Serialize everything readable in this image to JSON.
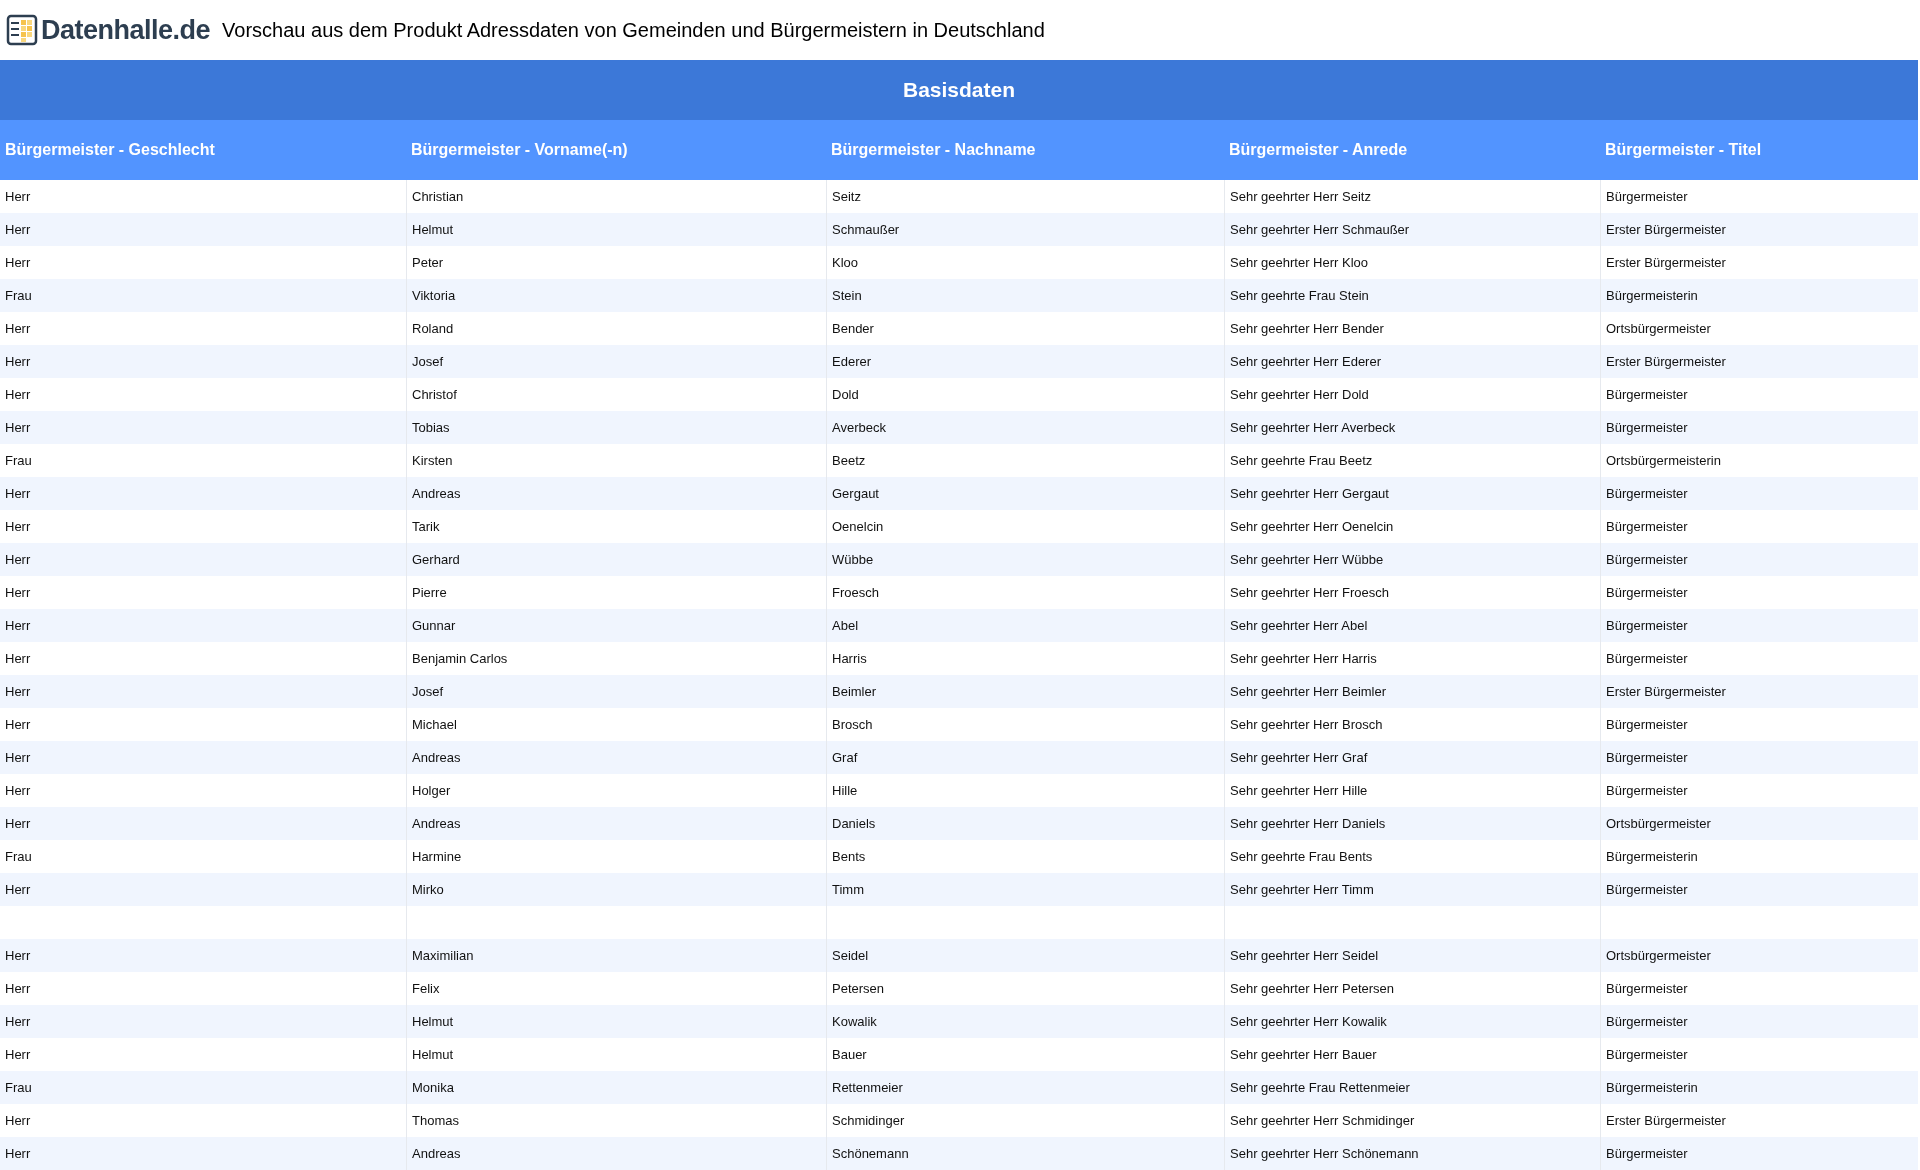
{
  "header": {
    "logo_text": "Datenhalle.de",
    "title": "Vorschau aus dem Produkt Adressdaten von Gemeinden und Bürgermeistern in Deutschland"
  },
  "section_title": "Basisdaten",
  "table": {
    "columns": [
      "Bürgermeister - Geschlecht",
      "Bürgermeister - Vorname(-n)",
      "Bürgermeister - Nachname",
      "Bürgermeister - Anrede",
      "Bürgermeister - Titel"
    ],
    "rows": [
      {
        "kind": "data",
        "cells": [
          "Herr",
          "Christian",
          "Seitz",
          "Sehr geehrter Herr Seitz",
          "Bürgermeister"
        ]
      },
      {
        "kind": "data",
        "cells": [
          "Herr",
          "Helmut",
          "Schmaußer",
          "Sehr geehrter Herr Schmaußer",
          "Erster Bürgermeister"
        ]
      },
      {
        "kind": "data",
        "cells": [
          "Herr",
          "Peter",
          "Kloo",
          "Sehr geehrter Herr Kloo",
          "Erster Bürgermeister"
        ]
      },
      {
        "kind": "data",
        "cells": [
          "Frau",
          "Viktoria",
          "Stein",
          "Sehr geehrte Frau Stein",
          "Bürgermeisterin"
        ]
      },
      {
        "kind": "data",
        "cells": [
          "Herr",
          "Roland",
          "Bender",
          "Sehr geehrter Herr Bender",
          "Ortsbürgermeister"
        ]
      },
      {
        "kind": "data",
        "cells": [
          "Herr",
          "Josef",
          "Ederer",
          "Sehr geehrter Herr Ederer",
          "Erster Bürgermeister"
        ]
      },
      {
        "kind": "data",
        "cells": [
          "Herr",
          "Christof",
          "Dold",
          "Sehr geehrter Herr Dold",
          "Bürgermeister"
        ]
      },
      {
        "kind": "data",
        "cells": [
          "Herr",
          "Tobias",
          "Averbeck",
          "Sehr geehrter Herr Averbeck",
          "Bürgermeister"
        ]
      },
      {
        "kind": "data",
        "cells": [
          "Frau",
          "Kirsten",
          "Beetz",
          "Sehr geehrte Frau Beetz",
          "Ortsbürgermeisterin"
        ]
      },
      {
        "kind": "data",
        "cells": [
          "Herr",
          "Andreas",
          "Gergaut",
          "Sehr geehrter Herr Gergaut",
          "Bürgermeister"
        ]
      },
      {
        "kind": "data",
        "cells": [
          "Herr",
          "Tarik",
          "Oenelcin",
          "Sehr geehrter Herr Oenelcin",
          "Bürgermeister"
        ]
      },
      {
        "kind": "data",
        "cells": [
          "Herr",
          "Gerhard",
          "Wübbe",
          "Sehr geehrter Herr Wübbe",
          "Bürgermeister"
        ]
      },
      {
        "kind": "data",
        "cells": [
          "Herr",
          "Pierre",
          "Froesch",
          "Sehr geehrter Herr Froesch",
          "Bürgermeister"
        ]
      },
      {
        "kind": "data",
        "cells": [
          "Herr",
          "Gunnar",
          "Abel",
          "Sehr geehrter Herr Abel",
          "Bürgermeister"
        ]
      },
      {
        "kind": "data",
        "cells": [
          "Herr",
          "Benjamin Carlos",
          "Harris",
          "Sehr geehrter Herr Harris",
          "Bürgermeister"
        ]
      },
      {
        "kind": "data",
        "cells": [
          "Herr",
          "Josef",
          "Beimler",
          "Sehr geehrter Herr Beimler",
          "Erster Bürgermeister"
        ]
      },
      {
        "kind": "data",
        "cells": [
          "Herr",
          "Michael",
          "Brosch",
          "Sehr geehrter Herr Brosch",
          "Bürgermeister"
        ]
      },
      {
        "kind": "data",
        "cells": [
          "Herr",
          "Andreas",
          "Graf",
          "Sehr geehrter Herr Graf",
          "Bürgermeister"
        ]
      },
      {
        "kind": "data",
        "cells": [
          "Herr",
          "Holger",
          "Hille",
          "Sehr geehrter Herr Hille",
          "Bürgermeister"
        ]
      },
      {
        "kind": "data",
        "cells": [
          "Herr",
          "Andreas",
          "Daniels",
          "Sehr geehrter Herr Daniels",
          "Ortsbürgermeister"
        ]
      },
      {
        "kind": "data",
        "cells": [
          "Frau",
          "Harmine",
          "Bents",
          "Sehr geehrte Frau Bents",
          "Bürgermeisterin"
        ]
      },
      {
        "kind": "data",
        "cells": [
          "Herr",
          "Mirko",
          "Timm",
          "Sehr geehrter Herr Timm",
          "Bürgermeister"
        ]
      },
      {
        "kind": "empty"
      },
      {
        "kind": "data",
        "cells": [
          "Herr",
          "Maximilian",
          "Seidel",
          "Sehr geehrter Herr Seidel",
          "Ortsbürgermeister"
        ]
      },
      {
        "kind": "data",
        "cells": [
          "Herr",
          "Felix",
          "Petersen",
          "Sehr geehrter Herr Petersen",
          "Bürgermeister"
        ]
      },
      {
        "kind": "data",
        "cells": [
          "Herr",
          "Helmut",
          "Kowalik",
          "Sehr geehrter Herr Kowalik",
          "Bürgermeister"
        ]
      },
      {
        "kind": "data",
        "cells": [
          "Herr",
          "Helmut",
          "Bauer",
          "Sehr geehrter Herr Bauer",
          "Bürgermeister"
        ]
      },
      {
        "kind": "data",
        "cells": [
          "Frau",
          "Monika",
          "Rettenmeier",
          "Sehr geehrte Frau Rettenmeier",
          "Bürgermeisterin"
        ]
      },
      {
        "kind": "data",
        "cells": [
          "Herr",
          "Thomas",
          "Schmidinger",
          "Sehr geehrter Herr Schmidinger",
          "Erster Bürgermeister"
        ]
      },
      {
        "kind": "data",
        "cells": [
          "Herr",
          "Andreas",
          "Schönemann",
          "Sehr geehrter Herr Schönemann",
          "Bürgermeister"
        ]
      }
    ]
  }
}
